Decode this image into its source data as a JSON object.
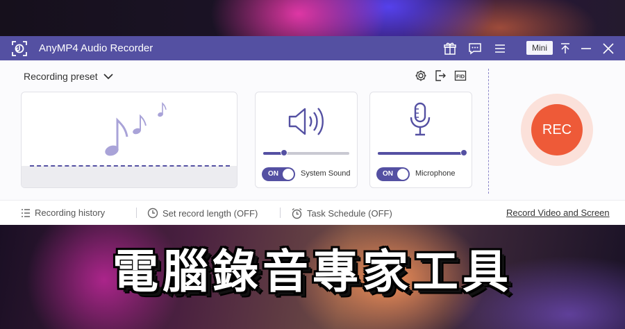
{
  "app": {
    "title": "AnyMP4 Audio Recorder",
    "mini_label": "Mini",
    "titlebar_icons": [
      "gift-icon",
      "chat-icon",
      "menu-icon",
      "pin-icon",
      "minimize-icon",
      "close-icon"
    ]
  },
  "toolbar": {
    "preset_label": "Recording preset",
    "icons": [
      "gear-icon",
      "export-icon",
      "fps-icon"
    ],
    "fps_icon_text": "FID"
  },
  "system_sound": {
    "toggle_label": "ON",
    "label": "System Sound",
    "volume_fraction": 0.24
  },
  "microphone": {
    "toggle_label": "ON",
    "label": "Microphone",
    "volume_fraction": 1.0
  },
  "rec_button": {
    "label": "REC"
  },
  "footer": {
    "history_label": "Recording history",
    "record_length_label": "Set record length (OFF)",
    "task_schedule_label": "Task Schedule (OFF)",
    "video_link_label": "Record Video and Screen"
  },
  "banner": {
    "text": "電腦錄音專家工具"
  },
  "colors": {
    "titlebar": "#5450a2",
    "accent": "#5450a2",
    "rec": "#ee5a38"
  }
}
